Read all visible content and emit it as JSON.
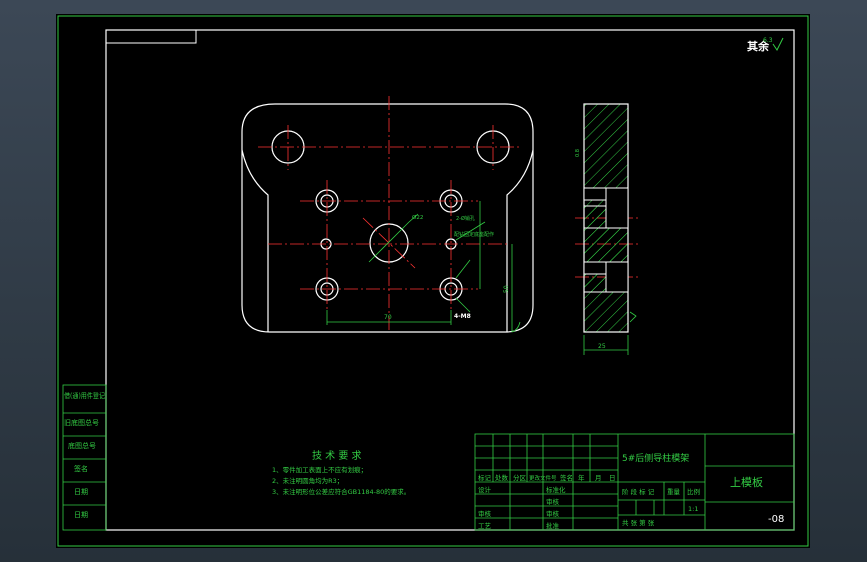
{
  "corner_text": "其余",
  "corner_roughness": "6.3",
  "dims": {
    "hole_dia": "Ø22",
    "width": "70",
    "height": "50",
    "thickness": "25",
    "note1": "2-Ø销孔",
    "note2": "配钻固定底座配作",
    "note3": "4-M8",
    "roughness_side": "0.8"
  },
  "tech": {
    "title": "技 术 要 求",
    "items": [
      "1、零件加工表面上不应有划痕；",
      "2、未注明圆角均为R3；",
      "3、未注明形位公差应符合GB1184-80的要求。"
    ]
  },
  "left_strip": [
    "借(通)用件登记",
    "旧底图总号",
    "底图总号",
    "签名",
    "日期",
    "日期"
  ],
  "title_block": {
    "drawing_title": "5#后侧导柱模架",
    "part_name": "上模板",
    "number": "-08",
    "row_headers": [
      "标记",
      "处数",
      "分区",
      "更改文件号",
      "签名",
      "年",
      "月",
      "日"
    ],
    "design": "设计",
    "standardize": "标准化",
    "review": "审核",
    "process": "工艺",
    "approve": "批准",
    "stage": "阶 段 标 记",
    "weight": "重量",
    "scale": "比例",
    "scale_val": "1:1",
    "sheet_info": "共  张  第  张",
    "counter": "审核",
    "check": "审核"
  }
}
